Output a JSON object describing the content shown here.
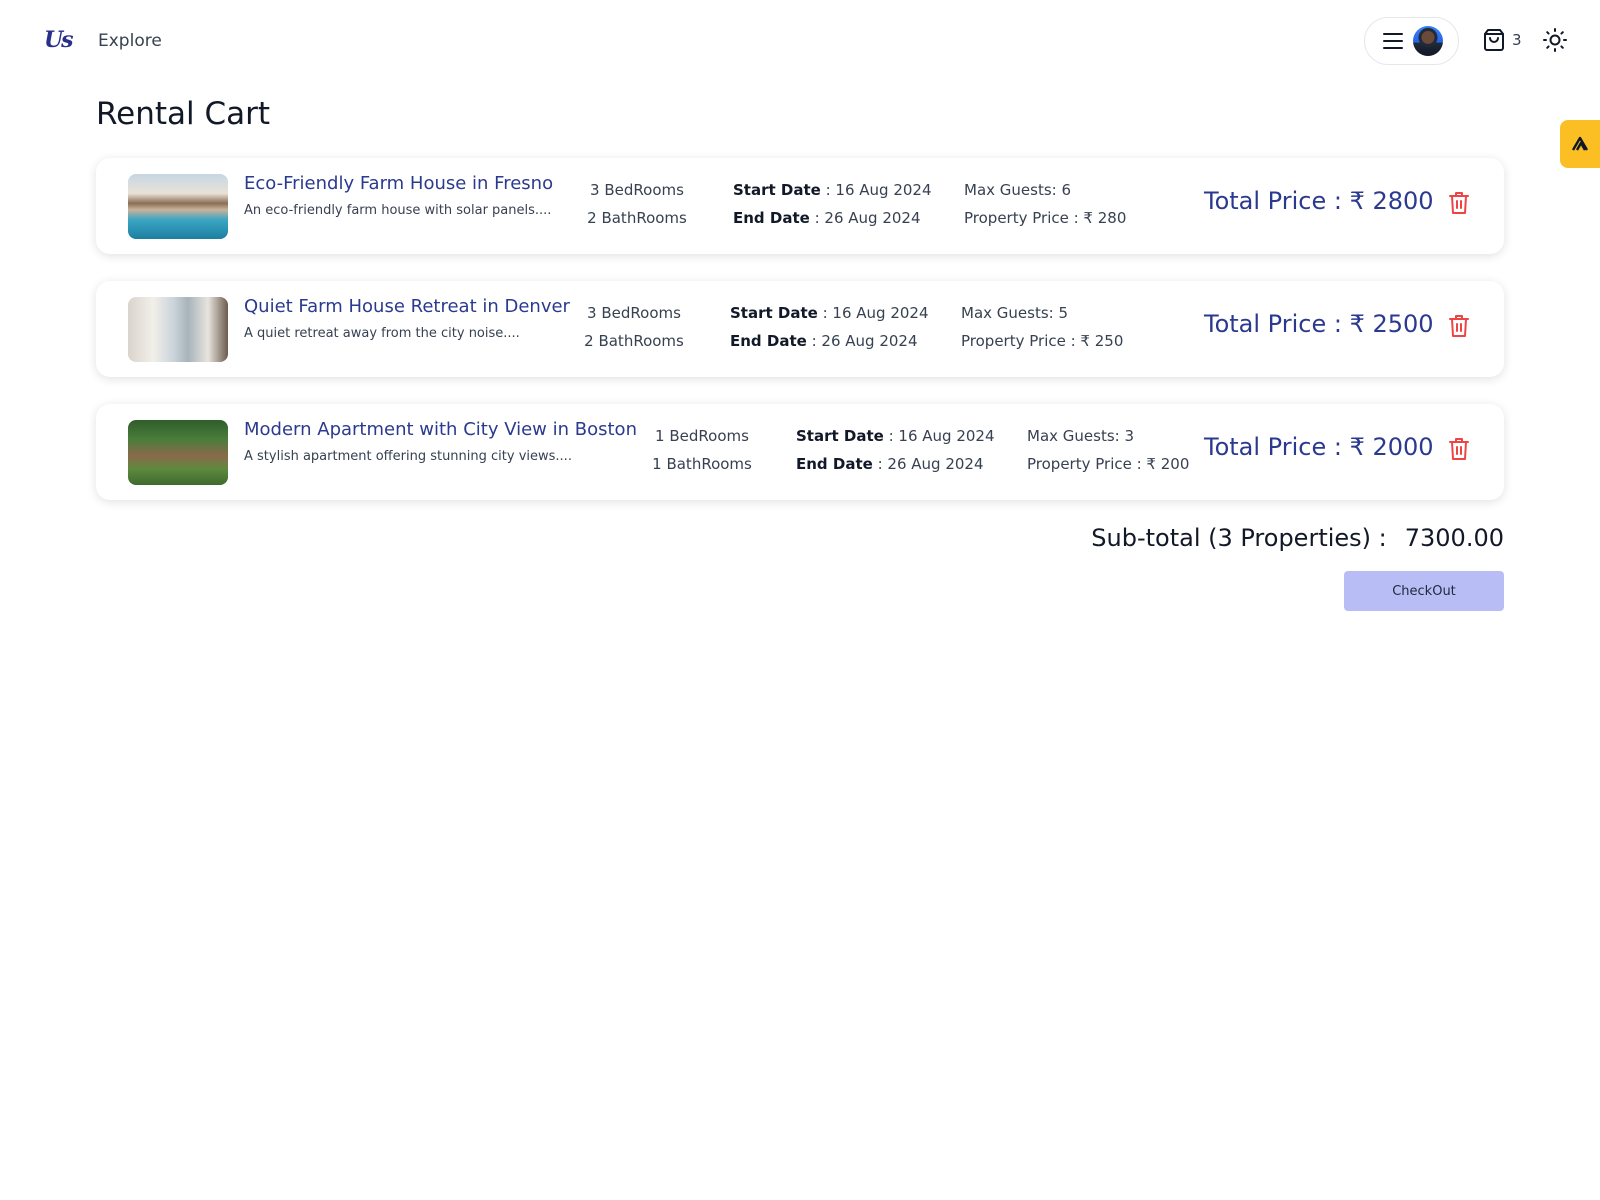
{
  "nav": {
    "logo": "Us",
    "explore_label": "Explore",
    "cart_count": "3"
  },
  "page": {
    "title": "Rental Cart"
  },
  "labels": {
    "start_date": "Start Date",
    "end_date": "End Date",
    "total_price": "Total Price :"
  },
  "cart": {
    "items": [
      {
        "title": "Eco-Friendly Farm House in Fresno",
        "description": "An eco-friendly farm house with solar panels....",
        "bedrooms": "3 BedRooms",
        "bathrooms": "2 BathRooms",
        "start_date": " : 16 Aug 2024",
        "end_date": " : 26 Aug 2024",
        "max_guests": "Max Guests: 6",
        "property_price": "Property Price : ₹ 280",
        "total_price": "Total Price : ₹ 2800"
      },
      {
        "title": "Quiet Farm House Retreat in Denver",
        "description": "A quiet retreat away from the city noise....",
        "bedrooms": "3 BedRooms",
        "bathrooms": "2 BathRooms",
        "start_date": " : 16 Aug 2024",
        "end_date": " : 26 Aug 2024",
        "max_guests": "Max Guests: 5",
        "property_price": "Property Price : ₹ 250",
        "total_price": "Total Price : ₹ 2500"
      },
      {
        "title": "Modern Apartment with City View in Boston",
        "description": "A stylish apartment offering stunning city views....",
        "bedrooms": "1 BedRooms",
        "bathrooms": "1 BathRooms",
        "start_date": " : 16 Aug 2024",
        "end_date": " : 26 Aug 2024",
        "max_guests": "Max Guests: 3",
        "property_price": "Property Price : ₹ 200",
        "total_price": "Total Price : ₹ 2000"
      }
    ]
  },
  "summary": {
    "subtotal_label": "Sub-total (3 Properties) :",
    "subtotal_value": "7300.00",
    "checkout_label": "CheckOut"
  },
  "icons": {
    "menu": "hamburger-icon",
    "cart": "shopping-bag-icon",
    "theme": "sun-icon",
    "delete": "trash-icon",
    "side_tab": "chevron-up-icon"
  },
  "colors": {
    "accent": "#2b3a8f",
    "delete": "#ef4444",
    "checkout_bg": "#b9bdf5",
    "side_tab": "#fbbf24"
  }
}
